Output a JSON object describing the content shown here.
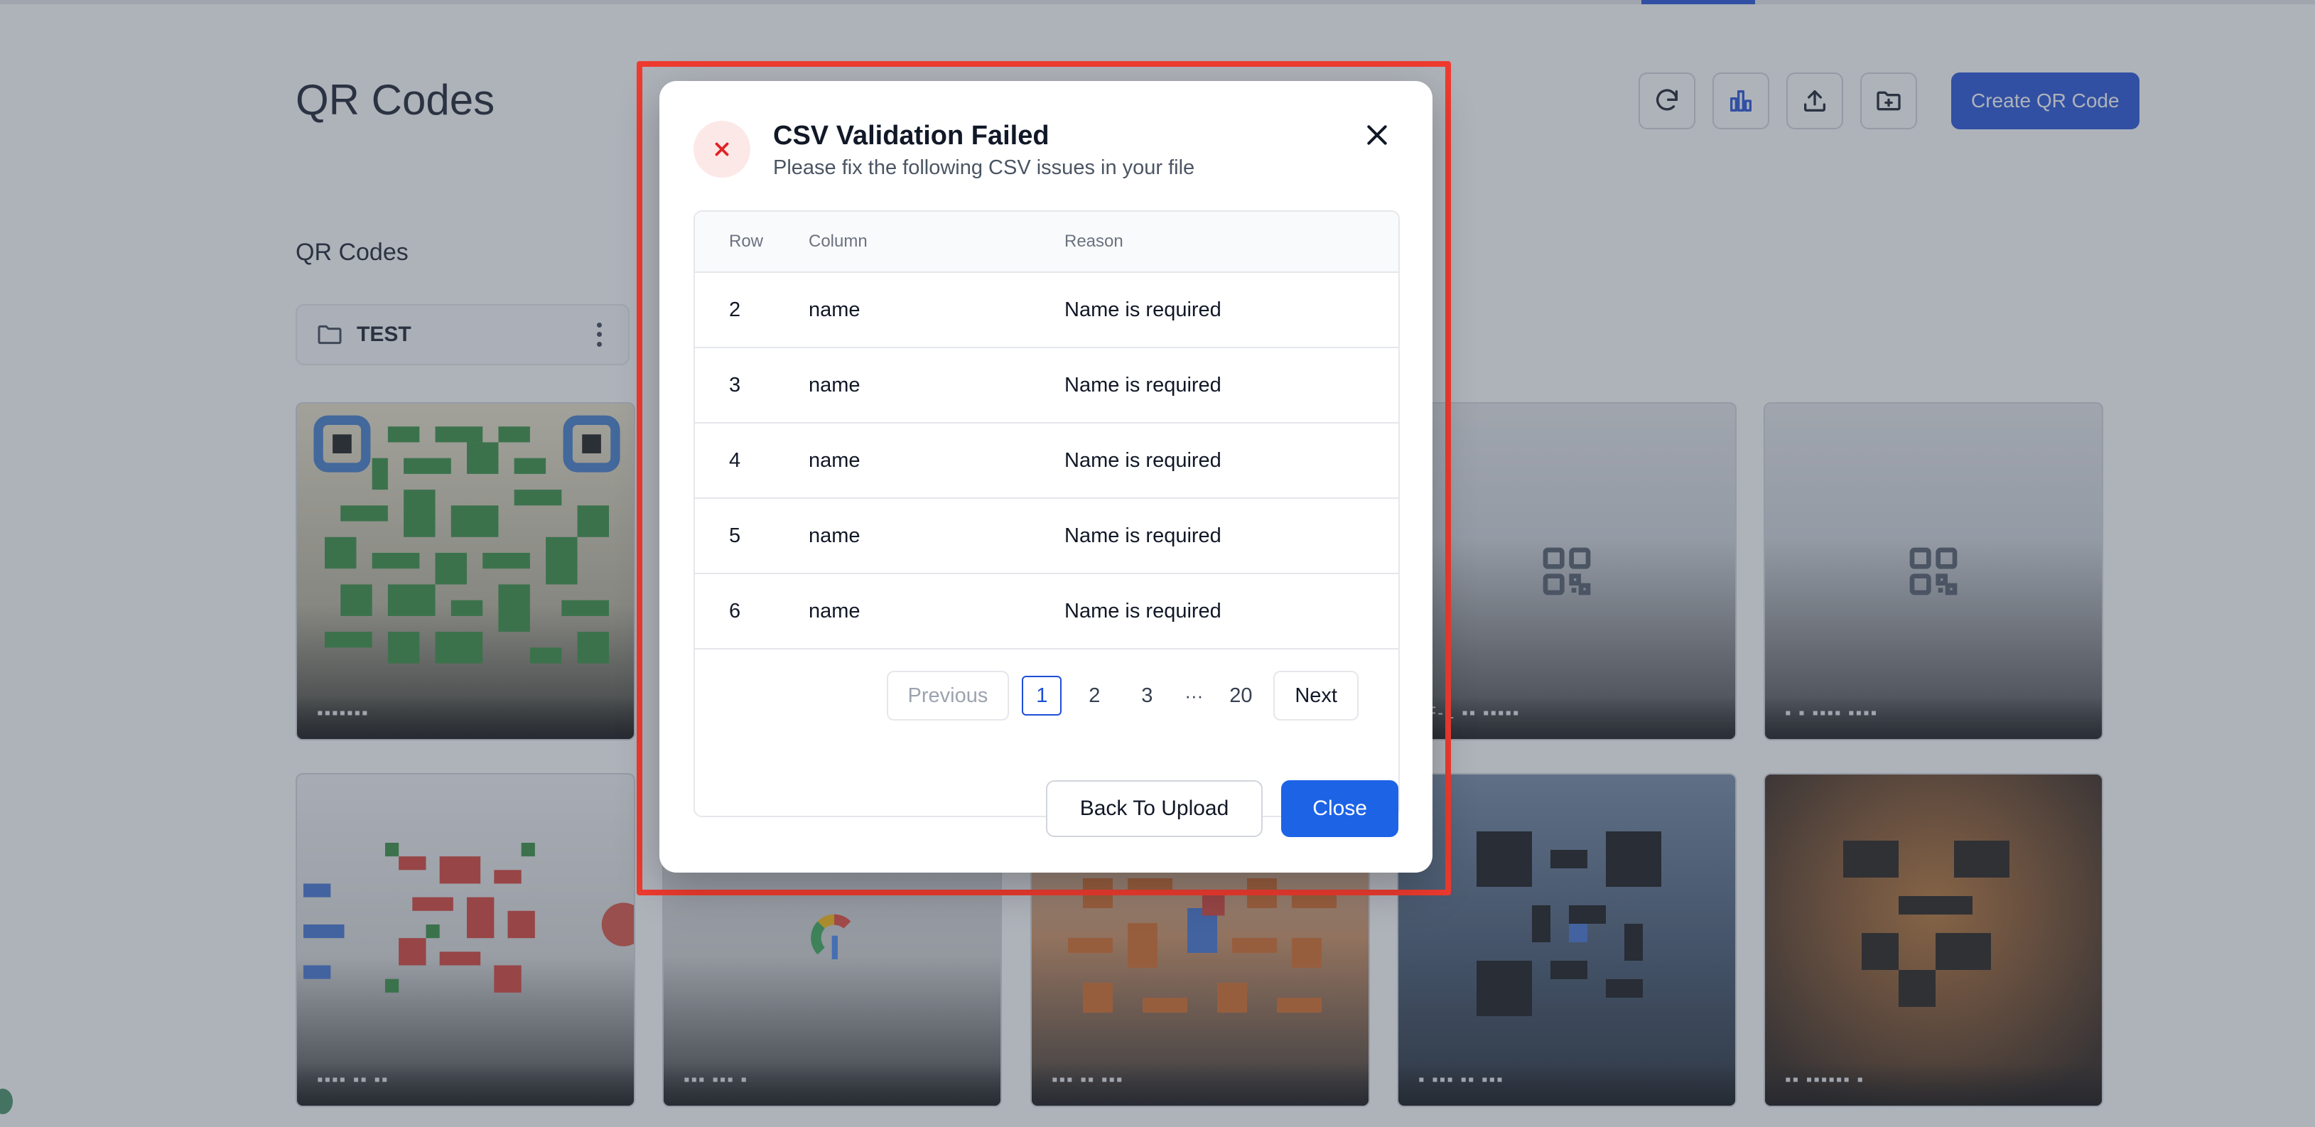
{
  "page": {
    "title": "QR Codes",
    "section_title": "QR Codes",
    "create_button": "Create QR Code",
    "toolbar_icons": [
      "refresh-icon",
      "bar-chart-icon",
      "upload-icon",
      "folder-plus-icon"
    ]
  },
  "folder": {
    "name": "TEST",
    "icon": "folder-icon"
  },
  "cards": [
    {
      "label": "▪▪▪▪▪▪▪",
      "style": "qr-green"
    },
    {
      "label": "",
      "style": "hidden"
    },
    {
      "label": "",
      "style": "hidden"
    },
    {
      "label": "▪F-1 ▪▪ ▪▪▪▪▪",
      "style": "placeholder"
    },
    {
      "label": "▪ ▪ ▪▪▪▪ ▪▪▪▪",
      "style": "placeholder"
    },
    {
      "label": "▪▪▪▪ ▪▪ ▪▪",
      "style": "qr-google"
    },
    {
      "label": "▪▪▪ ▪▪▪ ▪",
      "style": "google-logo"
    },
    {
      "label": "▪▪▪ ▪▪ ▪▪▪",
      "style": "qr-orange"
    },
    {
      "label": "▪ ▪▪▪ ▪▪ ▪▪▪",
      "style": "qr-dark"
    },
    {
      "label": "▪▪ ▪▪▪▪▪▪ ▪",
      "style": "qr-lion"
    }
  ],
  "modal": {
    "title": "CSV Validation Failed",
    "subtitle": "Please fix the following CSV issues in your file",
    "columns": {
      "row": "Row",
      "column": "Column",
      "reason": "Reason"
    },
    "rows": [
      {
        "row": "2",
        "column": "name",
        "reason": "Name is required"
      },
      {
        "row": "3",
        "column": "name",
        "reason": "Name is required"
      },
      {
        "row": "4",
        "column": "name",
        "reason": "Name is required"
      },
      {
        "row": "5",
        "column": "name",
        "reason": "Name is required"
      },
      {
        "row": "6",
        "column": "name",
        "reason": "Name is required"
      }
    ],
    "pagination": {
      "previous": "Previous",
      "next": "Next",
      "pages": [
        "1",
        "2",
        "3"
      ],
      "ellipsis": "···",
      "last": "20",
      "current": "1"
    },
    "back_button": "Back To Upload",
    "close_button": "Close"
  },
  "colors": {
    "primary": "#1d4ed8",
    "close_primary": "#1d63e6",
    "error": "#e02424",
    "error_bg": "#fde8e8",
    "highlight": "#ef3b2f"
  }
}
